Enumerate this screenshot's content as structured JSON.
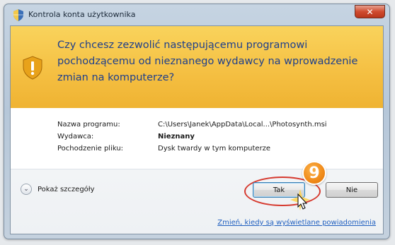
{
  "window": {
    "title": "Kontrola konta użytkownika",
    "close_glyph": "✕"
  },
  "banner": {
    "message": "Czy chcesz zezwolić następującemu programowi pochodzącemu od nieznanego wydawcy na wprowadzenie zmian na komputerze?",
    "icon": "warning-shield-icon"
  },
  "details": {
    "rows": [
      {
        "label": "Nazwa programu:",
        "value": "C:\\Users\\Janek\\AppData\\Local...\\Photosynth.msi"
      },
      {
        "label": "Wydawca:",
        "value": "Nieznany"
      },
      {
        "label": "Pochodzenie pliku:",
        "value": "Dysk twardy w tym komputerze"
      }
    ]
  },
  "footer": {
    "show_details_label": "Pokaż szczegóły",
    "yes_label": "Tak",
    "no_label": "Nie",
    "settings_link": "Zmień, kiedy są wyświetlane powiadomienia"
  },
  "annotation": {
    "step_number": "9",
    "highlight_color": "#d63a2f",
    "badge_color": "#f08a19"
  },
  "colors": {
    "banner": "#f5c043",
    "banner_text": "#1e3f8c",
    "link": "#1f5fbf"
  }
}
